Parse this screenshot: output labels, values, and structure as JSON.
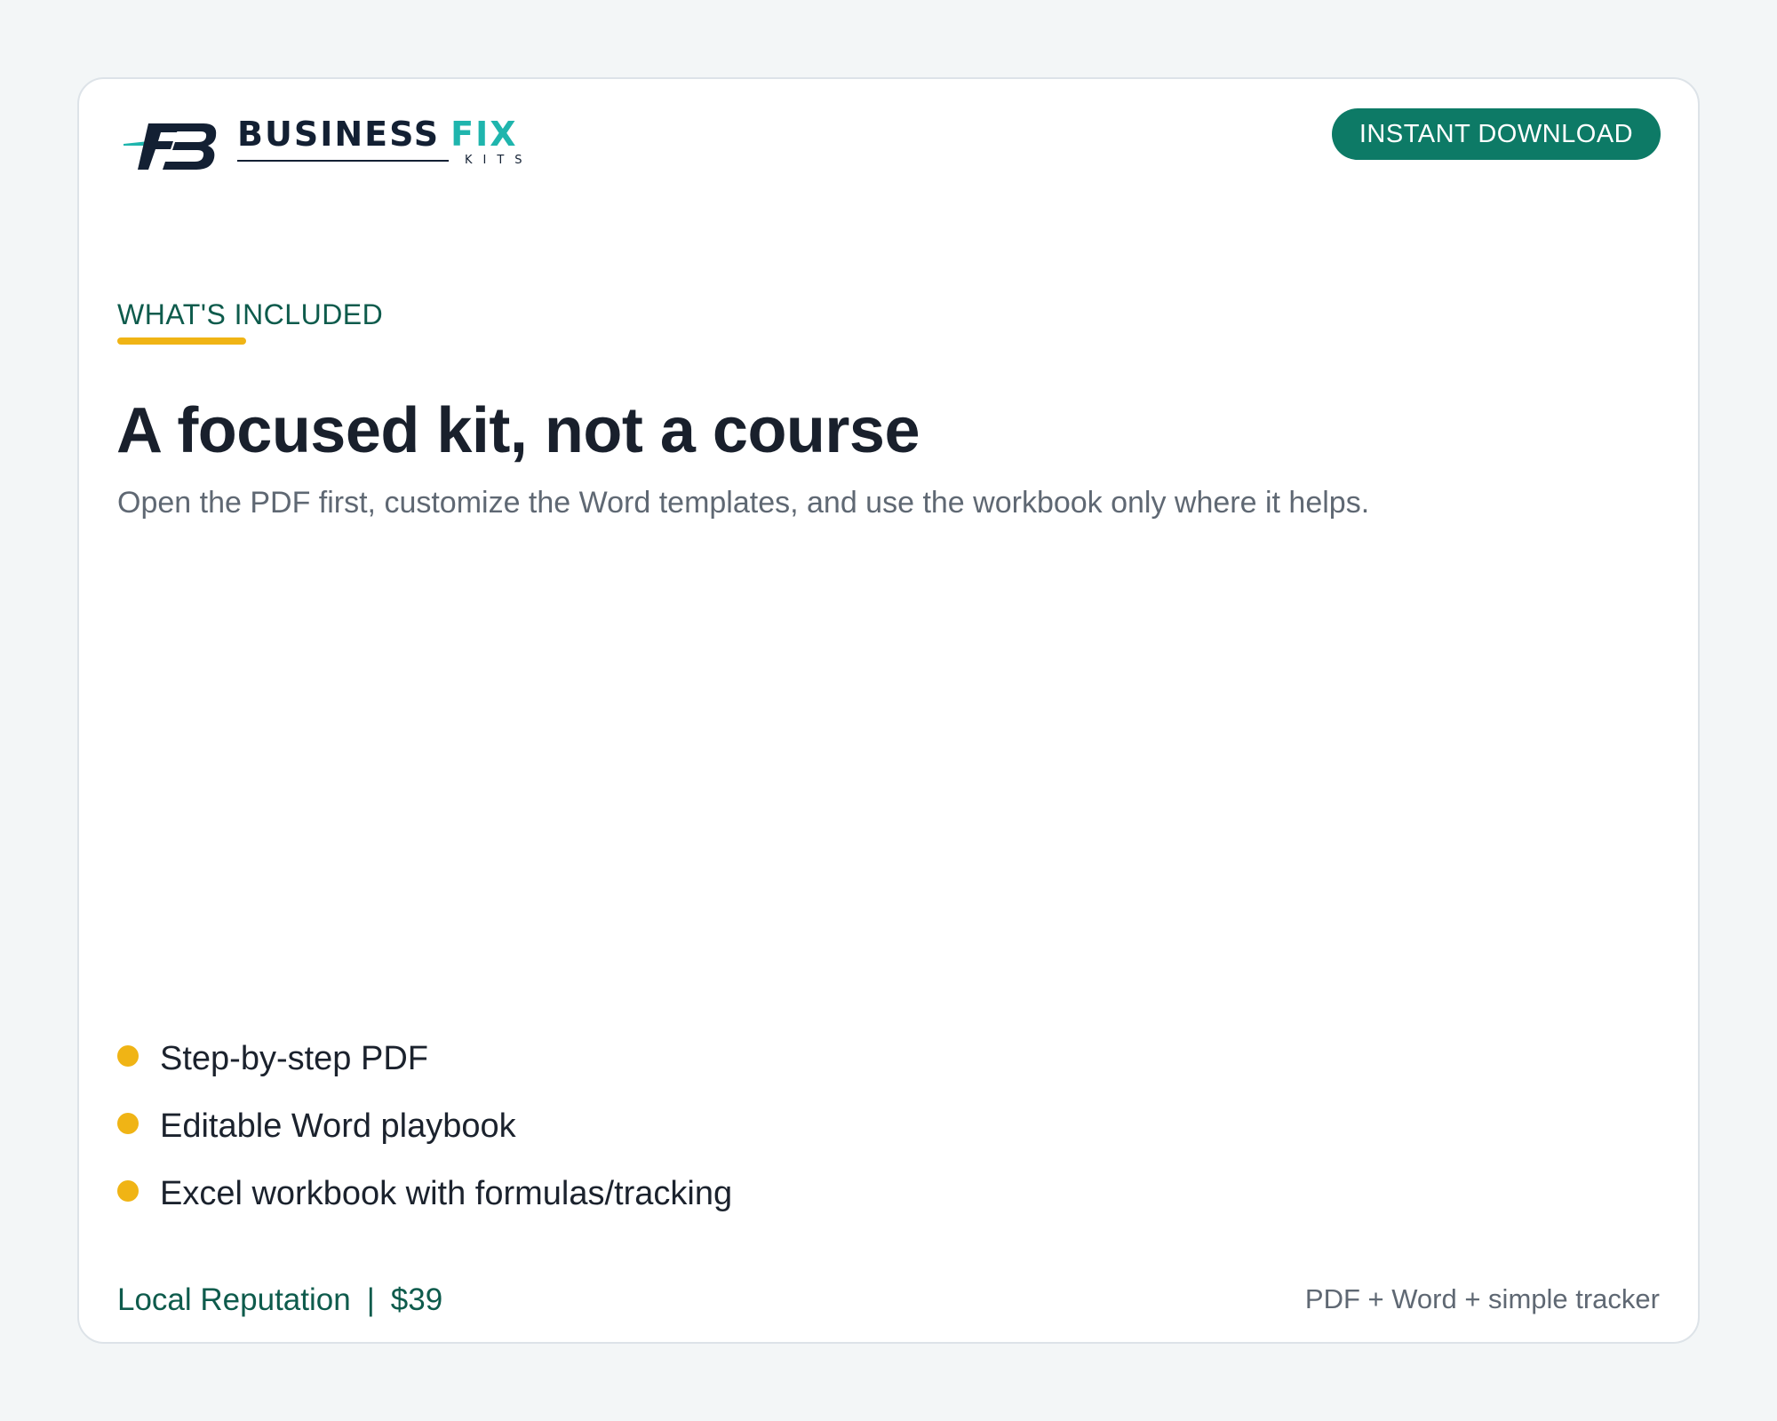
{
  "brand": {
    "name_primary": "BUSINESS",
    "name_accent": "FIX",
    "name_sub": "KITS",
    "accent_color": "#1fb5ad",
    "dark_color": "#132033",
    "logo_icon": "fb-monogram-icon"
  },
  "header": {
    "badge_label": "INSTANT DOWNLOAD",
    "badge_color": "#0d7a66"
  },
  "section": {
    "eyebrow": "WHAT'S INCLUDED",
    "eyebrow_color": "#0e5b4c",
    "underline_color": "#f0b415",
    "title": "A focused kit, not a course",
    "subtitle": "Open the PDF first, customize the Word templates, and use the workbook only where it helps."
  },
  "features": [
    "Step-by-step PDF",
    "Editable Word playbook",
    "Excel workbook with formulas/tracking"
  ],
  "footer": {
    "product": "Local Reputation",
    "separator": "|",
    "price": "$39",
    "formats": "PDF + Word + simple tracker"
  }
}
